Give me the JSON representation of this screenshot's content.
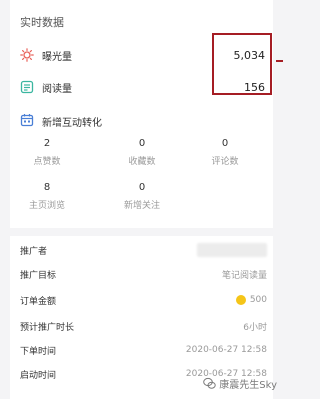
{
  "realtime": {
    "title": "实时数据",
    "metrics": [
      {
        "icon": "sun-icon",
        "label": "曝光量",
        "value": "5,034"
      },
      {
        "icon": "reading-icon",
        "label": "阅读量",
        "value": "156"
      }
    ],
    "interaction_title": "新增互动转化",
    "stats": [
      {
        "value": "2",
        "label": "点赞数"
      },
      {
        "value": "0",
        "label": "收藏数"
      },
      {
        "value": "0",
        "label": "评论数"
      },
      {
        "value": "8",
        "label": "主页浏览"
      },
      {
        "value": "0",
        "label": "新增关注"
      }
    ]
  },
  "details": {
    "rows": [
      {
        "key": "推广者",
        "value": ""
      },
      {
        "key": "推广目标",
        "value": "笔记阅读量"
      },
      {
        "key": "订单金额",
        "value": "500"
      },
      {
        "key": "预计推广时长",
        "value": "6小时"
      },
      {
        "key": "下单时间",
        "value": "2020-06-27 12:58"
      },
      {
        "key": "启动时间",
        "value": "2020-06-27 12:58"
      }
    ]
  },
  "watermark": {
    "text": "康震先生Sky"
  },
  "colors": {
    "highlight": "#a51d24",
    "coin": "#f5c518"
  }
}
